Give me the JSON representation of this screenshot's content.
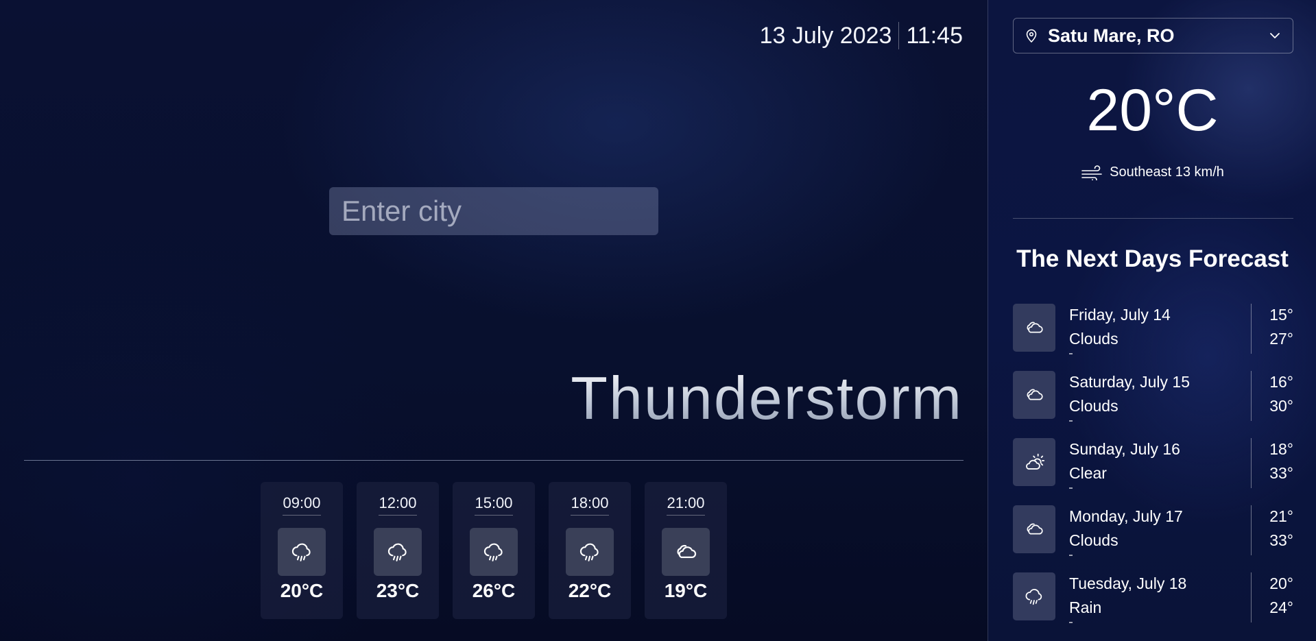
{
  "header": {
    "date": "13 July 2023",
    "time": "11:45"
  },
  "search": {
    "placeholder": "Enter city"
  },
  "current": {
    "condition": "Thunderstorm",
    "temperature": "20°C",
    "wind": "Southeast 13 km/h"
  },
  "location": {
    "selected": "Satu Mare, RO"
  },
  "hourly": [
    {
      "time": "09:00",
      "icon": "rain-icon",
      "temp": "20°C"
    },
    {
      "time": "12:00",
      "icon": "rain-icon",
      "temp": "23°C"
    },
    {
      "time": "15:00",
      "icon": "rain-icon",
      "temp": "26°C"
    },
    {
      "time": "18:00",
      "icon": "rain-icon",
      "temp": "22°C"
    },
    {
      "time": "21:00",
      "icon": "cloud-icon",
      "temp": "19°C"
    }
  ],
  "forecast": {
    "title": "The Next Days Forecast",
    "days": [
      {
        "day": "Friday, July 14",
        "condition": "Clouds",
        "icon": "cloud-icon",
        "min": "15°",
        "max": "27°"
      },
      {
        "day": "Saturday, July 15",
        "condition": "Clouds",
        "icon": "cloud-icon",
        "min": "16°",
        "max": "30°"
      },
      {
        "day": "Sunday, July 16",
        "condition": "Clear",
        "icon": "sun-cloud-icon",
        "min": "18°",
        "max": "33°"
      },
      {
        "day": "Monday, July 17",
        "condition": "Clouds",
        "icon": "cloud-icon",
        "min": "21°",
        "max": "33°"
      },
      {
        "day": "Tuesday, July 18",
        "condition": "Rain",
        "icon": "rain-icon",
        "min": "20°",
        "max": "24°"
      }
    ]
  }
}
